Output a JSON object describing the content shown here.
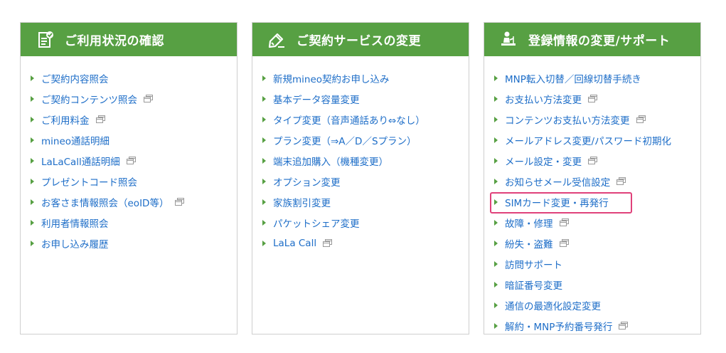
{
  "panels": [
    {
      "title": "ご利用状況の確認",
      "icon": "document-check-icon",
      "items": [
        {
          "label": "ご契約内容照会",
          "external": false
        },
        {
          "label": "ご契約コンテンツ照会",
          "external": true
        },
        {
          "label": "ご利用料金",
          "external": true
        },
        {
          "label": "mineo通話明細",
          "external": false
        },
        {
          "label": "LaLaCall通話明細",
          "external": true
        },
        {
          "label": "プレゼントコード照会",
          "external": false
        },
        {
          "label": "お客さま情報照会（eoID等）",
          "external": true
        },
        {
          "label": "利用者情報照会",
          "external": false
        },
        {
          "label": "お申し込み履歴",
          "external": false
        }
      ]
    },
    {
      "title": "ご契約サービスの変更",
      "icon": "pencil-edit-icon",
      "items": [
        {
          "label": "新規mineo契約お申し込み",
          "external": false
        },
        {
          "label": "基本データ容量変更",
          "external": false
        },
        {
          "label": "タイプ変更（音声通話あり⇔なし）",
          "external": false
        },
        {
          "label": "プラン変更（⇒A／D／Sプラン）",
          "external": false
        },
        {
          "label": "端末追加購入（機種変更）",
          "external": false
        },
        {
          "label": "オプション変更",
          "external": false
        },
        {
          "label": "家族割引変更",
          "external": false
        },
        {
          "label": "パケットシェア変更",
          "external": false
        },
        {
          "label": "LaLa Call",
          "external": true
        }
      ]
    },
    {
      "title": "登録情報の変更/サポート",
      "icon": "person-desk-icon",
      "items": [
        {
          "label": "MNP転入切替／回線切替手続き",
          "external": false
        },
        {
          "label": "お支払い方法変更",
          "external": true
        },
        {
          "label": "コンテンツお支払い方法変更",
          "external": true
        },
        {
          "label": "メールアドレス変更/パスワード初期化",
          "external": false
        },
        {
          "label": "メール設定・変更",
          "external": true
        },
        {
          "label": "お知らせメール受信設定",
          "external": true
        },
        {
          "label": "SIMカード変更・再発行",
          "external": false,
          "highlighted": true
        },
        {
          "label": "故障・修理",
          "external": true
        },
        {
          "label": "紛失・盗難",
          "external": true
        },
        {
          "label": "訪問サポート",
          "external": false
        },
        {
          "label": "暗証番号変更",
          "external": false
        },
        {
          "label": "通信の最適化設定変更",
          "external": false
        },
        {
          "label": "解約・MNP予約番号発行",
          "external": true
        }
      ]
    }
  ],
  "colors": {
    "header_bg": "#57a043",
    "header_text": "#ffffff",
    "link": "#1e6ec8",
    "arrow": "#57a043",
    "highlight": "#e0417a",
    "border": "#cfcfcf"
  }
}
